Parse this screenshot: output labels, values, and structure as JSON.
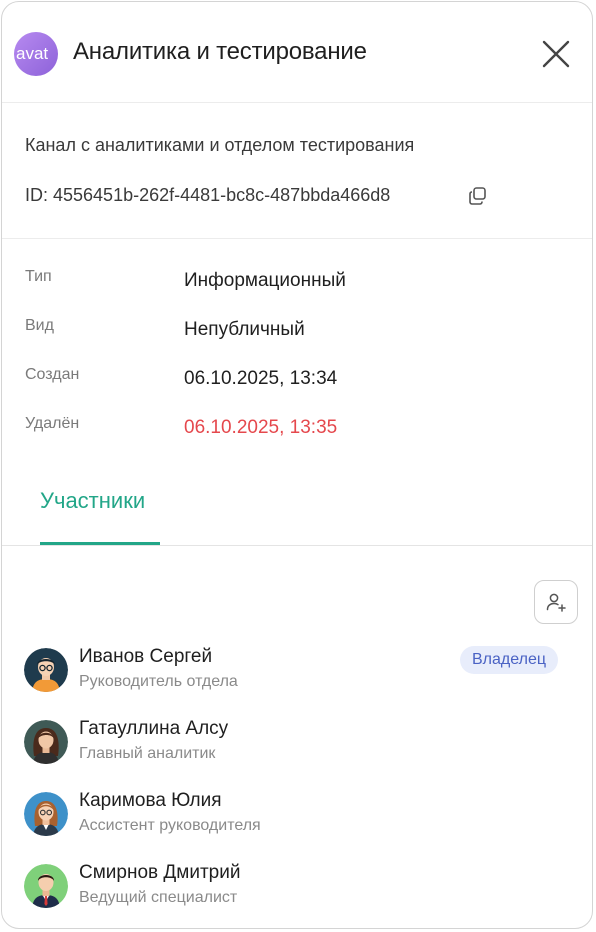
{
  "header": {
    "avatar_text": "avat",
    "title": "Аналитика и тестирование"
  },
  "channel": {
    "description": "Канал с аналитиками и отделом тестирования",
    "id_text": "ID: 4556451b-262f-4481-bc8c-487bbda466d8"
  },
  "info": [
    {
      "label": "Тип",
      "value": "Информационный"
    },
    {
      "label": "Вид",
      "value": "Непубличный"
    },
    {
      "label": "Создан",
      "value": "06.10.2025, 13:34"
    },
    {
      "label": "Удалён",
      "value": "06.10.2025, 13:35"
    }
  ],
  "tabs": [
    {
      "label": "Участники",
      "active": true
    }
  ],
  "members": [
    {
      "name": "Иванов Сергей",
      "role": "Руководитель отдела",
      "badge": "Владелец"
    },
    {
      "name": "Гатауллина Алсу",
      "role": "Главный аналитик"
    },
    {
      "name": "Каримова Юлия",
      "role": "Ассистент руководителя"
    },
    {
      "name": "Смирнов Дмитрий",
      "role": "Ведущий специалист"
    }
  ],
  "colors": {
    "accent": "#22a688",
    "deleted": "#e5484d",
    "badge_bg": "#e8edfb",
    "badge_text": "#4a62c4",
    "channel_avatar": "#a577e6"
  },
  "icons": {
    "close": "close-icon",
    "copy": "copy-icon",
    "add_member": "add-user-icon"
  }
}
